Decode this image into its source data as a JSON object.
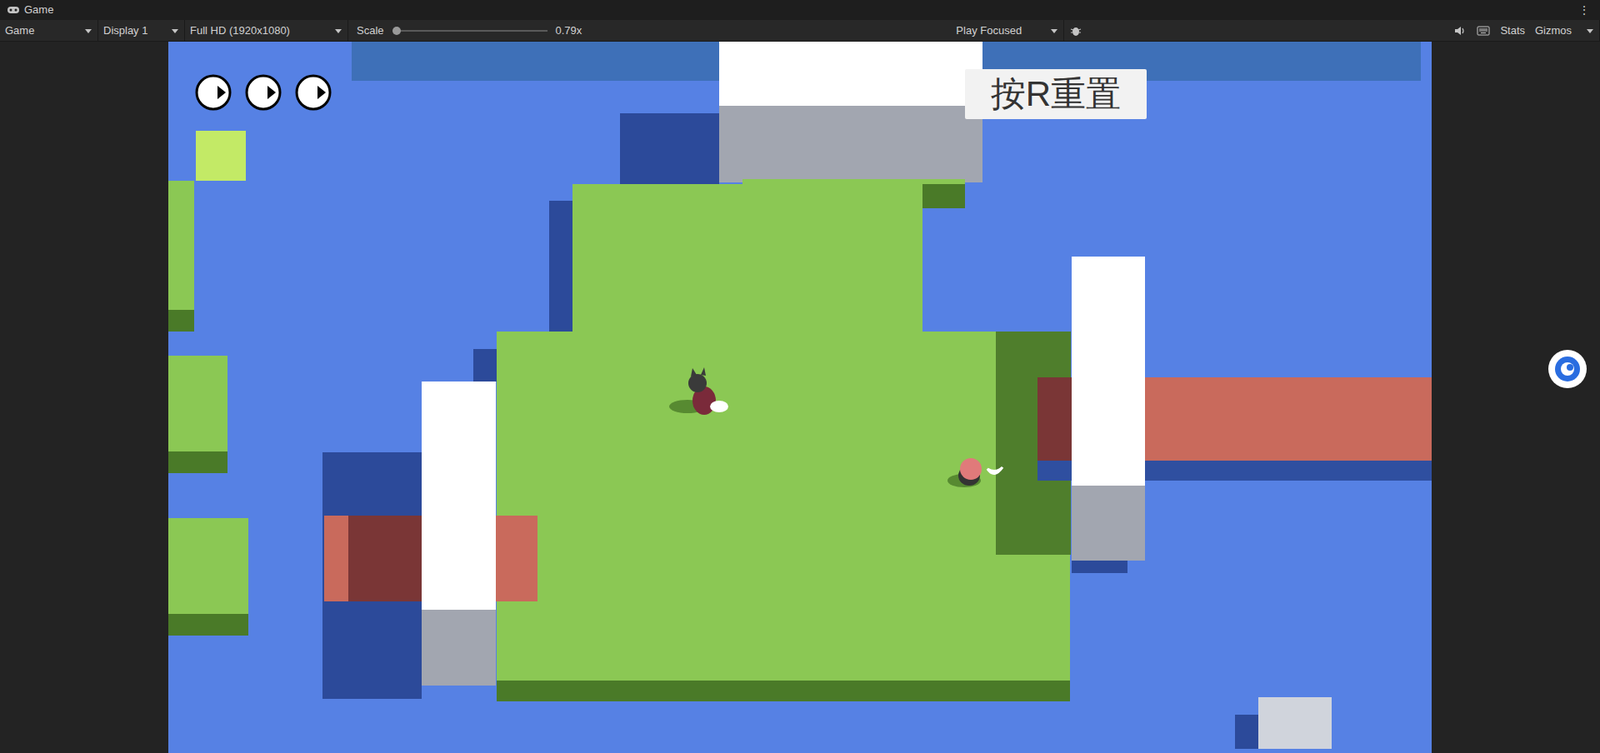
{
  "window": {
    "title": "Game",
    "menu": "⋮"
  },
  "toolbar": {
    "view": "Game",
    "display": "Display 1",
    "resolution": "Full HD (1920x1080)",
    "scale": {
      "label": "Scale",
      "value": "0.79x",
      "level": 0
    },
    "play_mode": "Play Focused",
    "stats": "Stats",
    "gizmos": "Gizmos"
  },
  "game": {
    "lives": [
      {
        "active": true
      },
      {
        "active": true
      },
      {
        "active": true
      }
    ],
    "reset_button": "按R重置"
  }
}
